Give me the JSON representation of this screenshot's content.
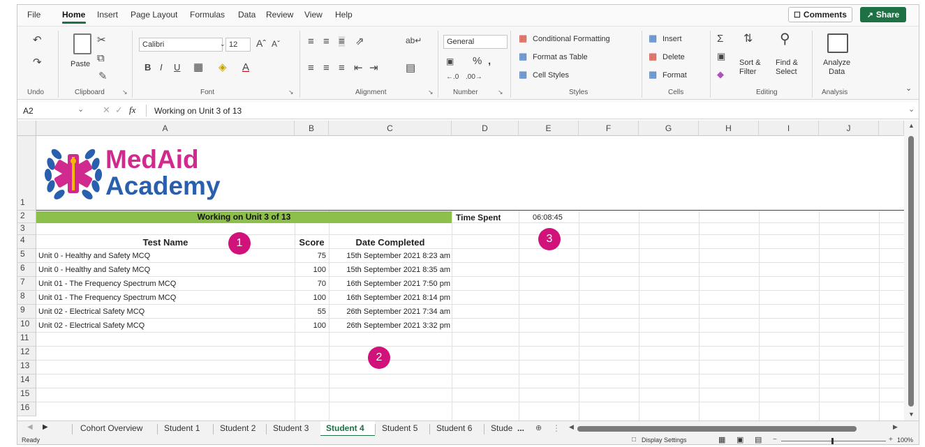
{
  "menu": {
    "items": [
      "File",
      "Home",
      "Insert",
      "Page Layout",
      "Formulas",
      "Data",
      "Review",
      "View",
      "Help"
    ],
    "comments": "Comments",
    "share": "Share"
  },
  "ribbon": {
    "undo_label": "Undo",
    "clipboard": {
      "paste": "Paste",
      "label": "Clipboard"
    },
    "font": {
      "name": "Calibri",
      "size": "12",
      "label": "Font"
    },
    "alignment": {
      "label": "Alignment"
    },
    "number": {
      "format": "General",
      "label": "Number"
    },
    "styles": {
      "conditional": "Conditional Formatting",
      "table": "Format as Table",
      "cell": "Cell Styles",
      "label": "Styles"
    },
    "cells": {
      "insert": "Insert",
      "delete": "Delete",
      "format": "Format",
      "label": "Cells"
    },
    "editing": {
      "sort1": "Sort &",
      "sort2": "Filter",
      "find1": "Find &",
      "find2": "Select",
      "label": "Editing"
    },
    "analysis": {
      "name1": "Analyze",
      "name2": "Data",
      "label": "Analysis"
    }
  },
  "formula": {
    "ref": "A2",
    "fx": "fx",
    "value": "Working on Unit 3 of 13"
  },
  "columns": [
    "A",
    "B",
    "C",
    "D",
    "E",
    "F",
    "G",
    "H",
    "I",
    "J"
  ],
  "rows": [
    "1",
    "2",
    "3",
    "4",
    "5",
    "6",
    "7",
    "8",
    "9",
    "10",
    "11",
    "12",
    "13",
    "14",
    "15",
    "16"
  ],
  "logo": {
    "line1": "MedAid",
    "line2": "Academy"
  },
  "sheet": {
    "banner": "Working on Unit 3 of 13",
    "time_label": "Time Spent",
    "time_value": "06:08:45",
    "headers": [
      "Test Name",
      "Score",
      "Date Completed"
    ],
    "tests": [
      {
        "name": "Unit 0 - Healthy and Safety MCQ",
        "score": "75",
        "date": "15th September 2021 8:23 am"
      },
      {
        "name": "Unit 0 - Healthy and Safety MCQ",
        "score": "100",
        "date": "15th September 2021 8:35 am"
      },
      {
        "name": "Unit 01 - The Frequency Spectrum MCQ",
        "score": "70",
        "date": "16th September 2021 7:50 pm"
      },
      {
        "name": "Unit 01 - The Frequency Spectrum MCQ",
        "score": "100",
        "date": "16th September 2021 8:14 pm"
      },
      {
        "name": "Unit 02 - Electrical Safety MCQ",
        "score": "55",
        "date": "26th September 2021 7:34 am"
      },
      {
        "name": "Unit 02 - Electrical Safety MCQ",
        "score": "100",
        "date": "26th September 2021 3:32 pm"
      }
    ]
  },
  "callouts": [
    "1",
    "2",
    "3"
  ],
  "tabs": [
    "Cohort Overview",
    "Student 1",
    "Student 2",
    "Student 3",
    "Student 4",
    "Student 5",
    "Student 6",
    "Stude"
  ],
  "tab_more": "...",
  "status": {
    "ready": "Ready",
    "display": "Display Settings",
    "zoom": "100%"
  },
  "colors": {
    "accent": "#1e7145",
    "banner": "#8dc04b",
    "callout": "#d1127a",
    "logo_magenta": "#d12a8f",
    "logo_blue": "#2a5fae"
  }
}
